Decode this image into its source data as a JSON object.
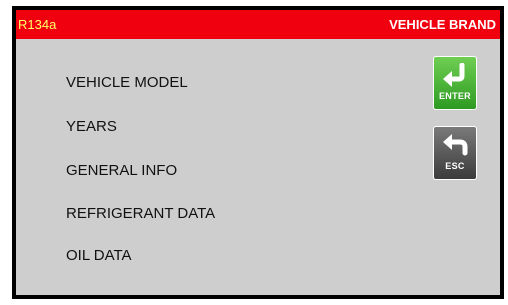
{
  "header": {
    "refrigerant": "R134a",
    "section_title": "VEHICLE BRAND"
  },
  "menu": {
    "items": [
      {
        "label": "VEHICLE MODEL"
      },
      {
        "label": "YEARS"
      },
      {
        "label": "GENERAL INFO"
      },
      {
        "label": "REFRIGERANT DATA"
      },
      {
        "label": "OIL DATA"
      }
    ]
  },
  "buttons": {
    "enter_label": "ENTER",
    "enter_icon": "enter-arrow-icon",
    "esc_label": "ESC",
    "esc_icon": "back-arrow-icon"
  },
  "colors": {
    "header_bg": "#f0000f",
    "refrigerant_text": "#ffff66",
    "screen_bg": "#cecece",
    "enter_button": "#3aa82c",
    "esc_button": "#555555"
  }
}
